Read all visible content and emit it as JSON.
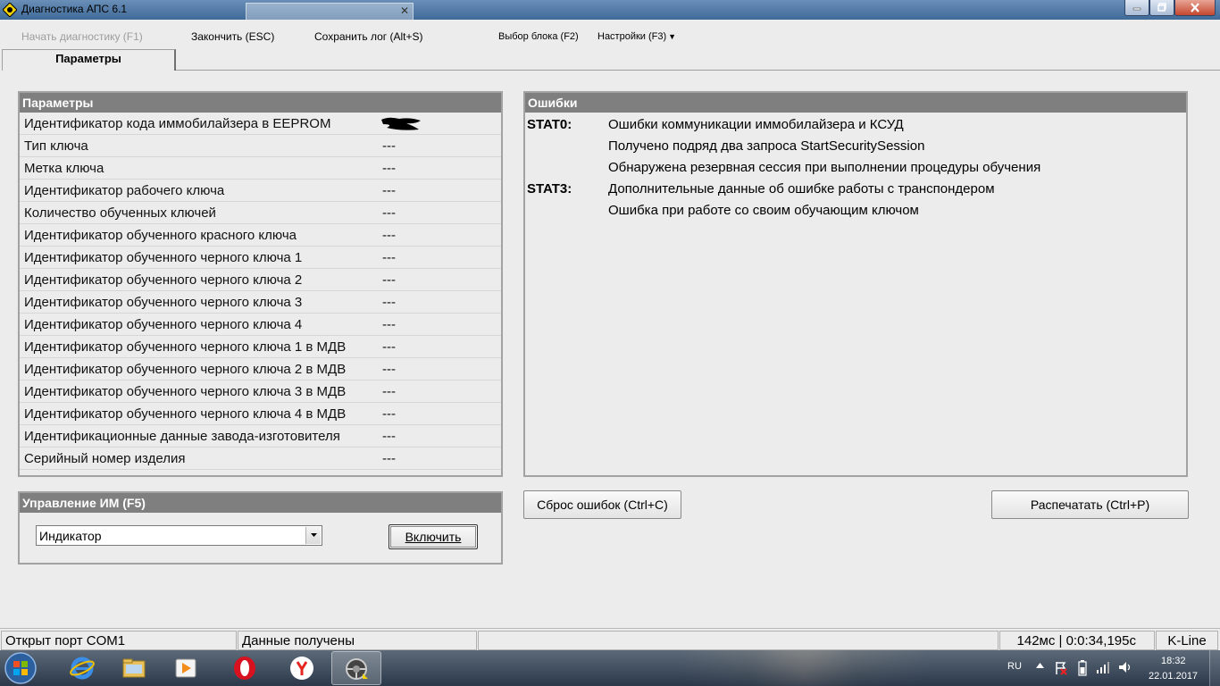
{
  "window": {
    "title": "Диагностика АПС 6.1"
  },
  "menu": {
    "start_diag": "Начать диагностику (F1)",
    "finish": "Закончить (ESC)",
    "save_log": "Сохранить лог (Alt+S)",
    "select_block": "Выбор блока (F2)",
    "settings": "Настройки (F3)"
  },
  "tabs": [
    {
      "label": "Параметры",
      "active": true
    }
  ],
  "params": {
    "header": "Параметры",
    "rows": [
      {
        "name": "Идентификатор кода иммобилайзера в EEPROM",
        "value": ""
      },
      {
        "name": "Тип ключа",
        "value": "---"
      },
      {
        "name": "Метка ключа",
        "value": "---"
      },
      {
        "name": "Идентификатор рабочего ключа",
        "value": "---"
      },
      {
        "name": "Количество обученных ключей",
        "value": "---"
      },
      {
        "name": "Идентификатор обученного красного ключа",
        "value": "---"
      },
      {
        "name": "Идентификатор обученного черного ключа 1",
        "value": "---"
      },
      {
        "name": "Идентификатор обученного черного ключа 2",
        "value": "---"
      },
      {
        "name": "Идентификатор обученного черного ключа 3",
        "value": "---"
      },
      {
        "name": "Идентификатор обученного черного ключа 4",
        "value": "---"
      },
      {
        "name": "Идентификатор обученного черного ключа 1 в МДВ",
        "value": "---"
      },
      {
        "name": "Идентификатор обученного черного ключа 2 в МДВ",
        "value": "---"
      },
      {
        "name": "Идентификатор обученного черного ключа 3 в МДВ",
        "value": "---"
      },
      {
        "name": "Идентификатор обученного черного ключа 4 в МДВ",
        "value": "---"
      },
      {
        "name": "Идентификационные данные завода-изготовителя",
        "value": "---"
      },
      {
        "name": "Серийный номер изделия",
        "value": "---"
      }
    ]
  },
  "errors": {
    "header": "Ошибки",
    "rows": [
      {
        "code": "STAT0:",
        "text": "Ошибки коммуникации иммобилайзера и КСУД"
      },
      {
        "code": "",
        "text": "Получено подряд два запроса StartSecuritySession"
      },
      {
        "code": "",
        "text": "Обнаружена резервная сессия при выполнении процедуры обучения"
      },
      {
        "code": "STAT3:",
        "text": "Дополнительные данные об ошибке работы с транспондером"
      },
      {
        "code": "",
        "text": "Ошибка при работе со своим обучающим ключом"
      }
    ]
  },
  "buttons": {
    "reset_errors": "Сброс ошибок (Ctrl+C)",
    "print": "Распечатать (Ctrl+P)"
  },
  "control": {
    "header": "Управление ИМ (F5)",
    "selected": "Индикатор",
    "enable_label": "Включить"
  },
  "status": {
    "port": "Открыт порт COM1",
    "data": "Данные получены",
    "extra": "",
    "timing": "142мс | 0:0:34,195с",
    "protocol": "K-Line"
  },
  "taskbar": {
    "lang": "RU",
    "time": "18:32",
    "date": "22.01.2017"
  },
  "colors": {
    "panel_header": "#7f7f7f",
    "window_bg": "#ececec",
    "titlebar": "#4f77a5"
  }
}
